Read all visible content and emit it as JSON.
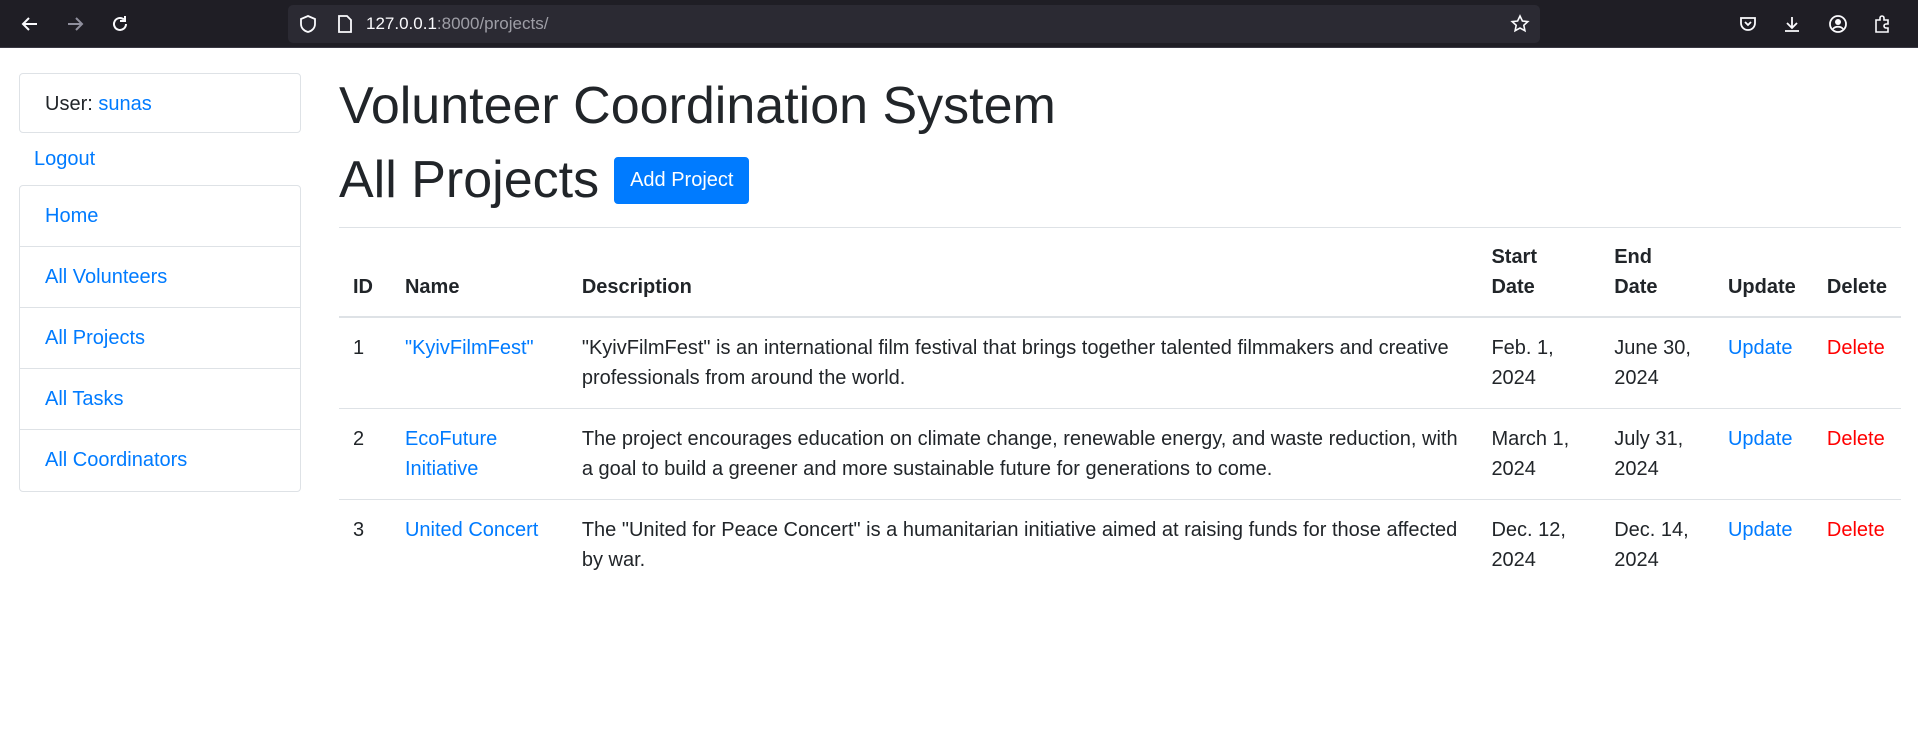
{
  "browser": {
    "url_host": "127.0.0.1",
    "url_path": ":8000/projects/"
  },
  "sidebar": {
    "user_label": "User:",
    "username": "sunas",
    "logout": "Logout",
    "items": [
      {
        "label": "Home"
      },
      {
        "label": "All Volunteers"
      },
      {
        "label": "All Projects"
      },
      {
        "label": "All Tasks"
      },
      {
        "label": "All Coordinators"
      }
    ]
  },
  "main": {
    "title": "Volunteer Coordination System",
    "heading": "All Projects",
    "add_button": "Add Project",
    "table": {
      "headers": {
        "id": "ID",
        "name": "Name",
        "description": "Description",
        "start_1": "Start",
        "start_2": "Date",
        "end_1": "End",
        "end_2": "Date",
        "update": "Update",
        "delete": "Delete"
      },
      "rows": [
        {
          "id": "1",
          "name": "\"KyivFilmFest\"",
          "description": "\"KyivFilmFest\" is an international film festival that brings together talented filmmakers and creative professionals from around the world.",
          "start": "Feb. 1, 2024",
          "end": "June 30, 2024",
          "update": "Update",
          "delete": "Delete"
        },
        {
          "id": "2",
          "name": "EcoFuture Initiative",
          "description": "The project encourages education on climate change, renewable energy, and waste reduction, with a goal to build a greener and more sustainable future for generations to come.",
          "start": "March 1, 2024",
          "end": "July 31, 2024",
          "update": "Update",
          "delete": "Delete"
        },
        {
          "id": "3",
          "name": "United Concert",
          "description": "The \"United for Peace Concert\" is a humanitarian initiative aimed at raising funds for those affected by war.",
          "start": "Dec. 12, 2024",
          "end": "Dec. 14, 2024",
          "update": "Update",
          "delete": "Delete"
        }
      ]
    }
  },
  "colors": {
    "link": "#007bff",
    "danger": "#ff0000",
    "chrome_bg": "#1f1e25",
    "urlbar_bg": "#2b2a33"
  }
}
